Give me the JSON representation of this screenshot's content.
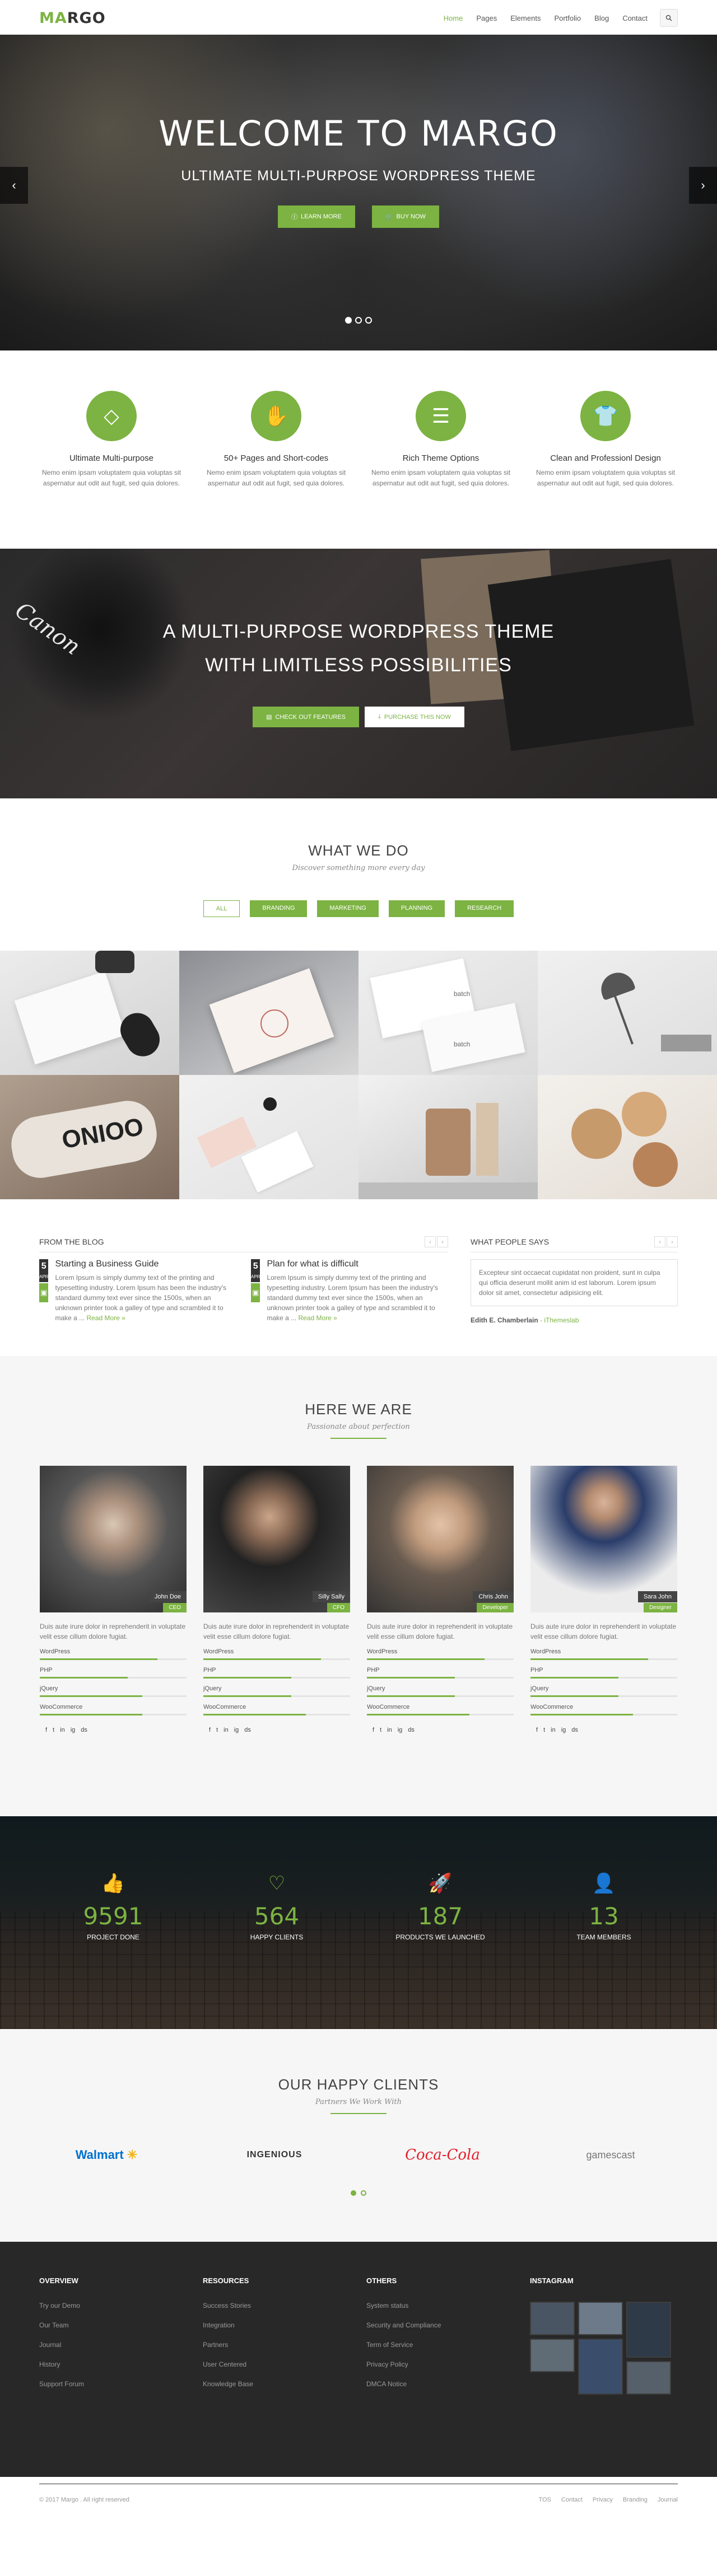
{
  "nav": {
    "logo_accent": "MA",
    "logo_rest": "RGO",
    "items": [
      "Home",
      "Pages",
      "Elements",
      "Portfolio",
      "Blog",
      "Contact"
    ]
  },
  "hero": {
    "title": "WELCOME TO MARGO",
    "subtitle": "ULTIMATE MULTI-PURPOSE WORDPRESS THEME",
    "btn_learn": "LEARN MORE",
    "btn_buy": "BUY NOW"
  },
  "features": [
    {
      "title": "Ultimate Multi-purpose",
      "text": "Nemo enim ipsam voluptatem quia voluptas sit aspernatur aut odit aut fugit, sed quia dolores."
    },
    {
      "title": "50+ Pages and Short-codes",
      "text": "Nemo enim ipsam voluptatem quia voluptas sit aspernatur aut odit aut fugit, sed quia dolores."
    },
    {
      "title": "Rich Theme Options",
      "text": "Nemo enim ipsam voluptatem quia voluptas sit aspernatur aut odit aut fugit, sed quia dolores."
    },
    {
      "title": "Clean and Professionl Design",
      "text": "Nemo enim ipsam voluptatem quia voluptas sit aspernatur aut odit aut fugit, sed quia dolores."
    }
  ],
  "parallax": {
    "line1": "A MULTI-PURPOSE WORDPRESS THEME",
    "line2": "WITH LIMITLESS POSSIBILITIES",
    "btn_features": "CHECK OUT FEATURES",
    "btn_purchase": "PURCHASE THIS NOW",
    "camera_text": "Canon"
  },
  "whatwedo": {
    "title": "WHAT WE DO",
    "subtitle": "Discover something more every day",
    "filters": [
      "ALL",
      "BRANDING",
      "MARKETING",
      "PLANNING",
      "RESEARCH"
    ]
  },
  "portfolio_texts": {
    "card1": "batch",
    "card2": "batch",
    "tube": "ONIOO"
  },
  "blog": {
    "heading": "FROM THE BLOG",
    "posts": [
      {
        "day": "5",
        "month": "APR",
        "title": "Starting a Business Guide",
        "text": "Lorem Ipsum is simply dummy text of the printing and typesetting industry. Lorem Ipsum has been the industry's standard dummy text ever since the 1500s, when an unknown printer took a galley of type and scrambled it to make a ...",
        "more": "Read More »"
      },
      {
        "day": "5",
        "month": "APR",
        "title": "Plan for what is difficult",
        "text": "Lorem Ipsum is simply dummy text of the printing and typesetting industry. Lorem Ipsum has been the industry's standard dummy text ever since the 1500s, when an unknown printer took a galley of type and scrambled it to make a ...",
        "more": "Read More »"
      }
    ]
  },
  "testimonials": {
    "heading": "WHAT PEOPLE SAYS",
    "quote": "Excepteur sint occaecat cupidatat non proident, sunt in culpa qui officia deserunt mollit anim id est laborum. Lorem ipsum dolor sit amet, consectetur adipisicing elit.",
    "author": "Edith E. Chamberlain",
    "company": " - iThemeslab"
  },
  "team": {
    "title": "HERE WE ARE",
    "subtitle": "Passionate about perfection",
    "members": [
      {
        "name": "John Doe",
        "role": "CEO",
        "desc": "Duis aute irure dolor in reprehenderit in voluptate velit esse cillum dolore fugiat."
      },
      {
        "name": "Silly Sally",
        "role": "CFO",
        "desc": "Duis aute irure dolor in reprehenderit in voluptate velit esse cillum dolore fugiat."
      },
      {
        "name": "Chris John",
        "role": "Developer",
        "desc": "Duis aute irure dolor in reprehenderit in voluptate velit esse cillum dolore fugiat."
      },
      {
        "name": "Sara John",
        "role": "Designer",
        "desc": "Duis aute irure dolor in reprehenderit in voluptate velit esse cillum dolore fugiat."
      }
    ],
    "skills": [
      "WordPress",
      "PHP",
      "jQuery",
      "WooCommerce"
    ],
    "skill_levels": [
      [
        0.8,
        0.6,
        0.7,
        0.7
      ],
      [
        0.8,
        0.6,
        0.6,
        0.7
      ],
      [
        0.8,
        0.6,
        0.6,
        0.7
      ],
      [
        0.8,
        0.6,
        0.6,
        0.7
      ]
    ],
    "social": [
      "f",
      "t",
      "in",
      "ig",
      "ds"
    ]
  },
  "stats": [
    {
      "icon": "thumbs-up-icon",
      "number": "9591",
      "label": "PROJECT DONE"
    },
    {
      "icon": "heart-icon",
      "number": "564",
      "label": "HAPPY CLIENTS"
    },
    {
      "icon": "rocket-icon",
      "number": "187",
      "label": "PRODUCTS WE LAUNCHED"
    },
    {
      "icon": "user-icon",
      "number": "13",
      "label": "TEAM MEMBERS"
    }
  ],
  "clients": {
    "title": "OUR HAPPY CLIENTS",
    "subtitle": "Partners We Work With",
    "logos": [
      "Walmart",
      "INGENIOUS",
      "Coca-Cola",
      "gamescast"
    ]
  },
  "footer": {
    "cols": [
      {
        "heading": "OVERVIEW",
        "items": [
          "Try our Demo",
          "Our Team",
          "Journal",
          "History",
          "Support Forum"
        ]
      },
      {
        "heading": "RESOURCES",
        "items": [
          "Success Stories",
          "Integration",
          "Partners",
          "User Centered",
          "Knowledge Base"
        ]
      },
      {
        "heading": "OTHERS",
        "items": [
          "System status",
          "Security and Compliance",
          "Term of Service",
          "Privacy Policy",
          "DMCA Notice"
        ]
      }
    ],
    "instagram": "INSTAGRAM",
    "copyright": "© 2017 Margo . All right reserved",
    "links": [
      "TOS",
      "Contact",
      "Privacy",
      "Branding",
      "Journal"
    ]
  },
  "colors": {
    "accent": "#7cb342",
    "dark": "#282828"
  }
}
